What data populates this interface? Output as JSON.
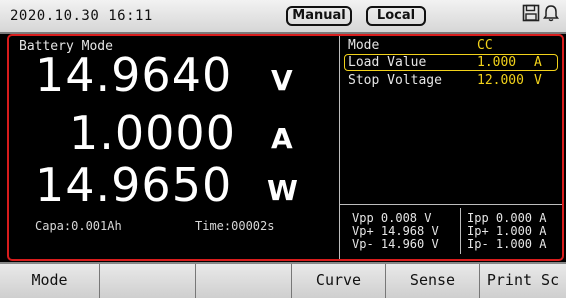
{
  "status_bar": {
    "datetime": "2020.10.30 16:11",
    "mode_pill": "Manual",
    "control_pill": "Local",
    "icons": [
      "save-icon",
      "bell-icon"
    ]
  },
  "readout": {
    "mode_label": "Battery Mode",
    "voltage": "14.9640",
    "voltage_unit": "V",
    "current": "1.0000",
    "current_unit": "A",
    "power": "14.9650",
    "power_unit": "W",
    "capacity": "Capa:0.001Ah",
    "time": "Time:00002s"
  },
  "params": {
    "mode_label": "Mode",
    "mode_value": "CC",
    "load_label": "Load Value",
    "load_value": "1.000",
    "load_unit": "A",
    "stop_label": "Stop Voltage",
    "stop_value": "12.000",
    "stop_unit": "V"
  },
  "stats": {
    "vpp": "Vpp 0.008 V",
    "vp_plus": "Vp+ 14.968 V",
    "vp_minus": "Vp- 14.960 V",
    "ipp": "Ipp 0.000 A",
    "ip_plus": "Ip+ 1.000 A",
    "ip_minus": "Ip- 1.000 A"
  },
  "softkeys": [
    "Mode",
    "",
    "",
    "Curve",
    "Sense",
    "Print Sc"
  ],
  "colors": {
    "frame_accent": "#d81c1c",
    "param_value": "#f2d21b"
  }
}
